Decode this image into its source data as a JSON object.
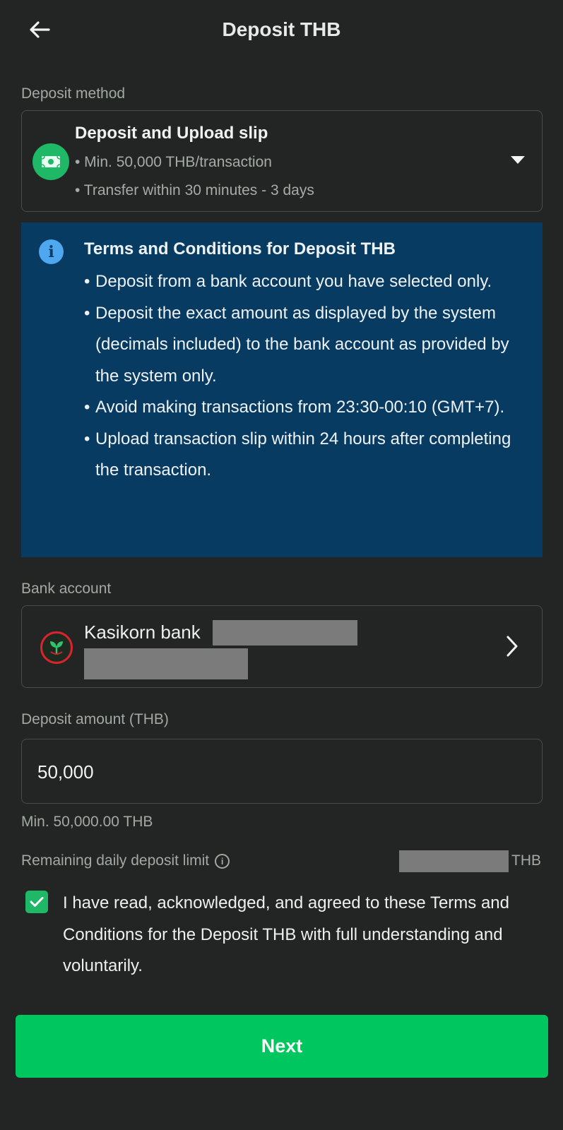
{
  "header": {
    "title": "Deposit THB",
    "back_icon": "arrow-left-icon"
  },
  "deposit_method": {
    "label": "Deposit method",
    "title": "Deposit and Upload slip",
    "line1": "• Min. 50,000 THB/transaction",
    "line2": "• Transfer within 30 minutes - 3 days",
    "icon": "cash-transfer-icon",
    "caret_icon": "caret-down-icon",
    "icon_color": "#1fb866"
  },
  "terms": {
    "title": "Terms and Conditions for Deposit THB",
    "items": [
      "Deposit from a bank account you have selected only.",
      "Deposit the exact amount as displayed by the system (decimals included) to the bank account as provided by the system only.",
      "Avoid making transactions from 23:30-00:10 (GMT+7).",
      " Upload transaction slip within 24 hours after completing the transaction."
    ],
    "background": "#073b62",
    "info_icon": "info-icon"
  },
  "bank_account": {
    "label": "Bank account",
    "bank_name": "Kasikorn bank",
    "logo_icon": "kasikorn-bank-logo-icon",
    "chevron_icon": "chevron-right-icon"
  },
  "deposit_amount": {
    "label": "Deposit amount (THB)",
    "value": "50,000",
    "min_note": "Min. 50,000.00 THB"
  },
  "daily_limit": {
    "label": "Remaining daily deposit limit",
    "unit": "THB",
    "info_icon": "info-circle-icon"
  },
  "agreement": {
    "checked": true,
    "text": "I have read, acknowledged, and agreed to these Terms and Conditions for the Deposit THB with full understanding and voluntarily."
  },
  "next_button": {
    "label": "Next",
    "color": "#00c65f"
  },
  "theme": {
    "background": "#222523",
    "accent": "#1fb866"
  }
}
